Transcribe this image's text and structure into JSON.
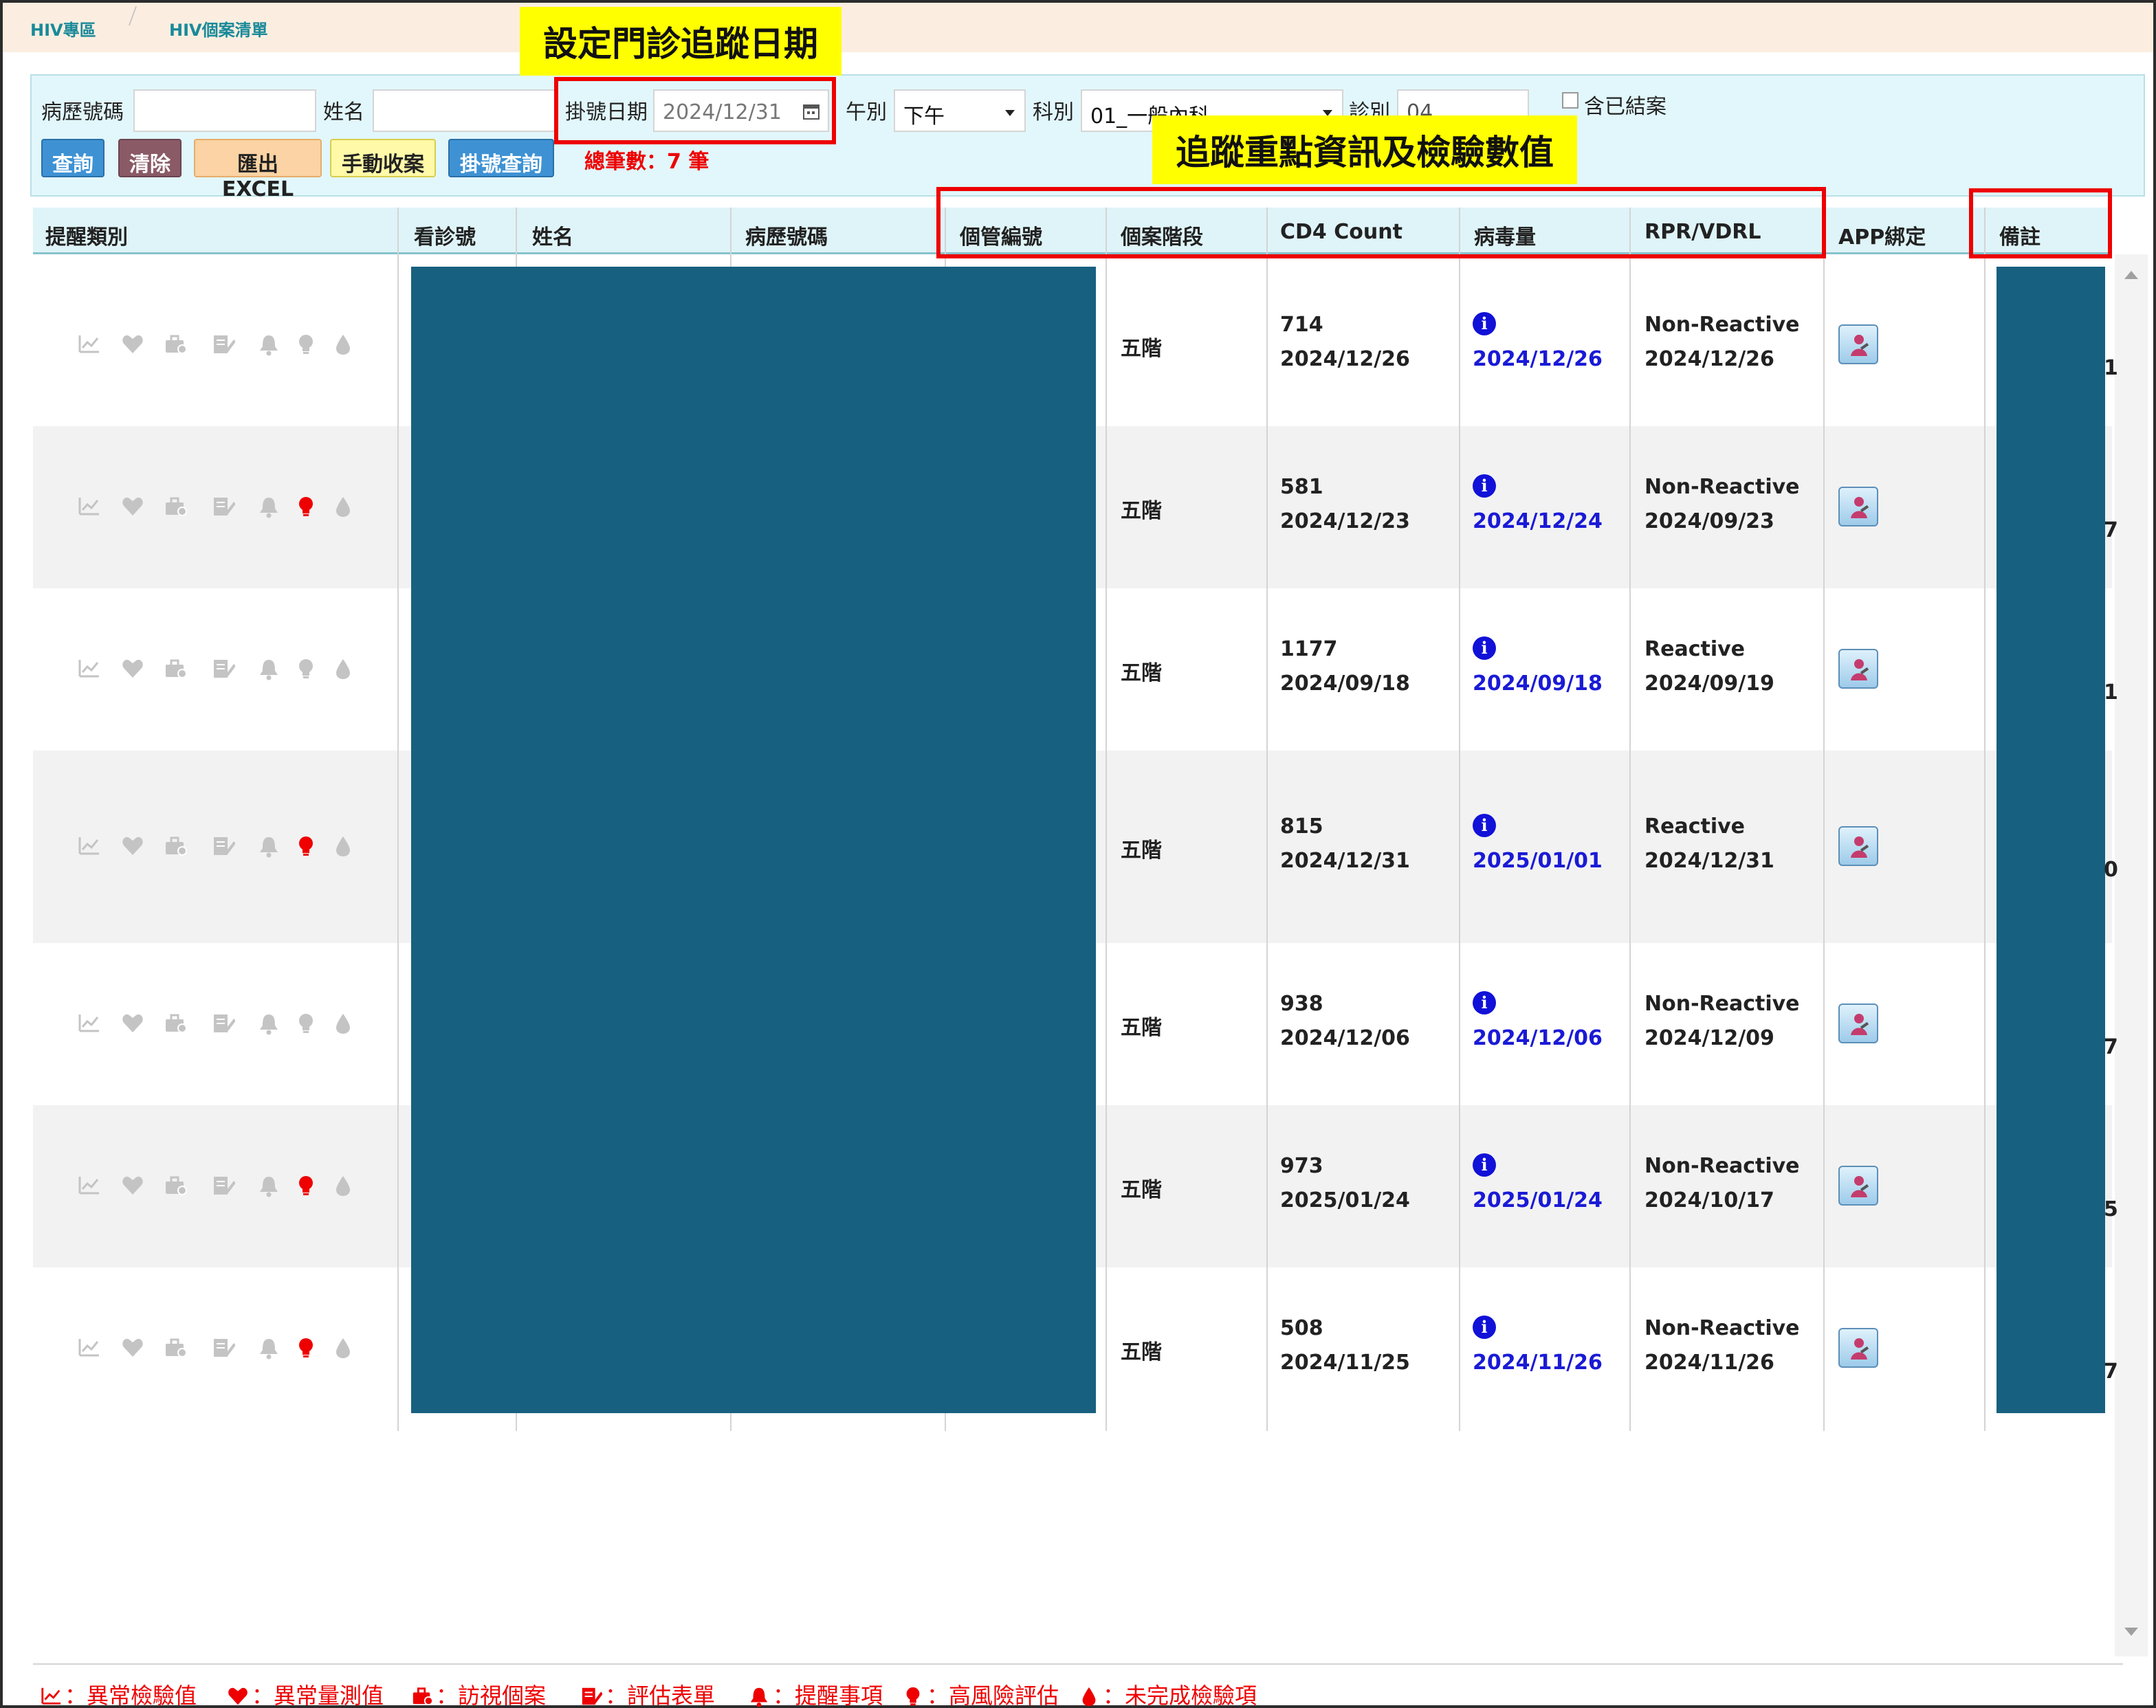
{
  "breadcrumb": {
    "home": "HIV專區",
    "current": "HIV個案清單"
  },
  "annotations": {
    "date_callout": "設定門診追蹤日期",
    "columns_callout": "追蹤重點資訊及檢驗數值"
  },
  "search": {
    "chart_no_label": "病歷號碼",
    "chart_no_value": "",
    "name_label": "姓名",
    "name_value": "",
    "reg_date_label": "掛號日期",
    "reg_date_value": "2024/12/31",
    "session_label": "午別",
    "session_value": "下午",
    "dept_label": "科別",
    "dept_value": "01_一般內科",
    "room_label": "診別",
    "room_value": "04",
    "include_closed_label": "含已結案",
    "buttons": {
      "query": "查詢",
      "clear": "清除",
      "export": "匯出EXCEL",
      "manual_close": "手動收案",
      "reg_query": "掛號查詢"
    },
    "total": "總筆數：7 筆"
  },
  "table": {
    "headers": [
      "提醒類別",
      "看診號",
      "姓名",
      "病歷號碼",
      "個管編號",
      "個案階段",
      "CD4 Count",
      "病毒量",
      "RPR/VDRL",
      "APP綁定",
      "備註"
    ],
    "rows": [
      {
        "stage": "五階",
        "cd4": "714",
        "cd4_date": "2024/12/26",
        "vl_date": "2024/12/26",
        "rpr": "Non-Reactive",
        "rpr_date": "2024/12/26",
        "high_risk": false,
        "edge": "1"
      },
      {
        "stage": "五階",
        "cd4": "581",
        "cd4_date": "2024/12/23",
        "vl_date": "2024/12/24",
        "rpr": "Non-Reactive",
        "rpr_date": "2024/09/23",
        "high_risk": true,
        "edge": "7"
      },
      {
        "stage": "五階",
        "cd4": "1177",
        "cd4_date": "2024/09/18",
        "vl_date": "2024/09/18",
        "rpr": "Reactive",
        "rpr_date": "2024/09/19",
        "high_risk": false,
        "edge": "1"
      },
      {
        "stage": "五階",
        "cd4": "815",
        "cd4_date": "2024/12/31",
        "vl_date": "2025/01/01",
        "rpr": "Reactive",
        "rpr_date": "2024/12/31",
        "high_risk": true,
        "edge": "0"
      },
      {
        "stage": "五階",
        "cd4": "938",
        "cd4_date": "2024/12/06",
        "vl_date": "2024/12/06",
        "rpr": "Non-Reactive",
        "rpr_date": "2024/12/09",
        "high_risk": false,
        "edge": "7"
      },
      {
        "stage": "五階",
        "cd4": "973",
        "cd4_date": "2025/01/24",
        "vl_date": "2025/01/24",
        "rpr": "Non-Reactive",
        "rpr_date": "2024/10/17",
        "high_risk": true,
        "edge": "5"
      },
      {
        "stage": "五階",
        "cd4": "508",
        "cd4_date": "2024/11/25",
        "vl_date": "2024/11/26",
        "rpr": "Non-Reactive",
        "rpr_date": "2024/11/26",
        "high_risk": true,
        "edge": "7"
      }
    ]
  },
  "legend": [
    {
      "icon": "chart-line-icon",
      "label": "：異常檢驗值"
    },
    {
      "icon": "heart-icon",
      "label": "：異常量測值"
    },
    {
      "icon": "briefcase-icon",
      "label": "：訪視個案"
    },
    {
      "icon": "form-edit-icon",
      "label": "：評估表單"
    },
    {
      "icon": "bell-icon",
      "label": "：提醒事項"
    },
    {
      "icon": "lightbulb-icon",
      "label": "：高風險評估"
    },
    {
      "icon": "drop-icon",
      "label": "：未完成檢驗項"
    }
  ],
  "colors": {
    "mask": "#176080",
    "alert_red": "#ee0000",
    "link_blue": "#1a1ad6",
    "icon_grey": "#c4c4c4"
  }
}
